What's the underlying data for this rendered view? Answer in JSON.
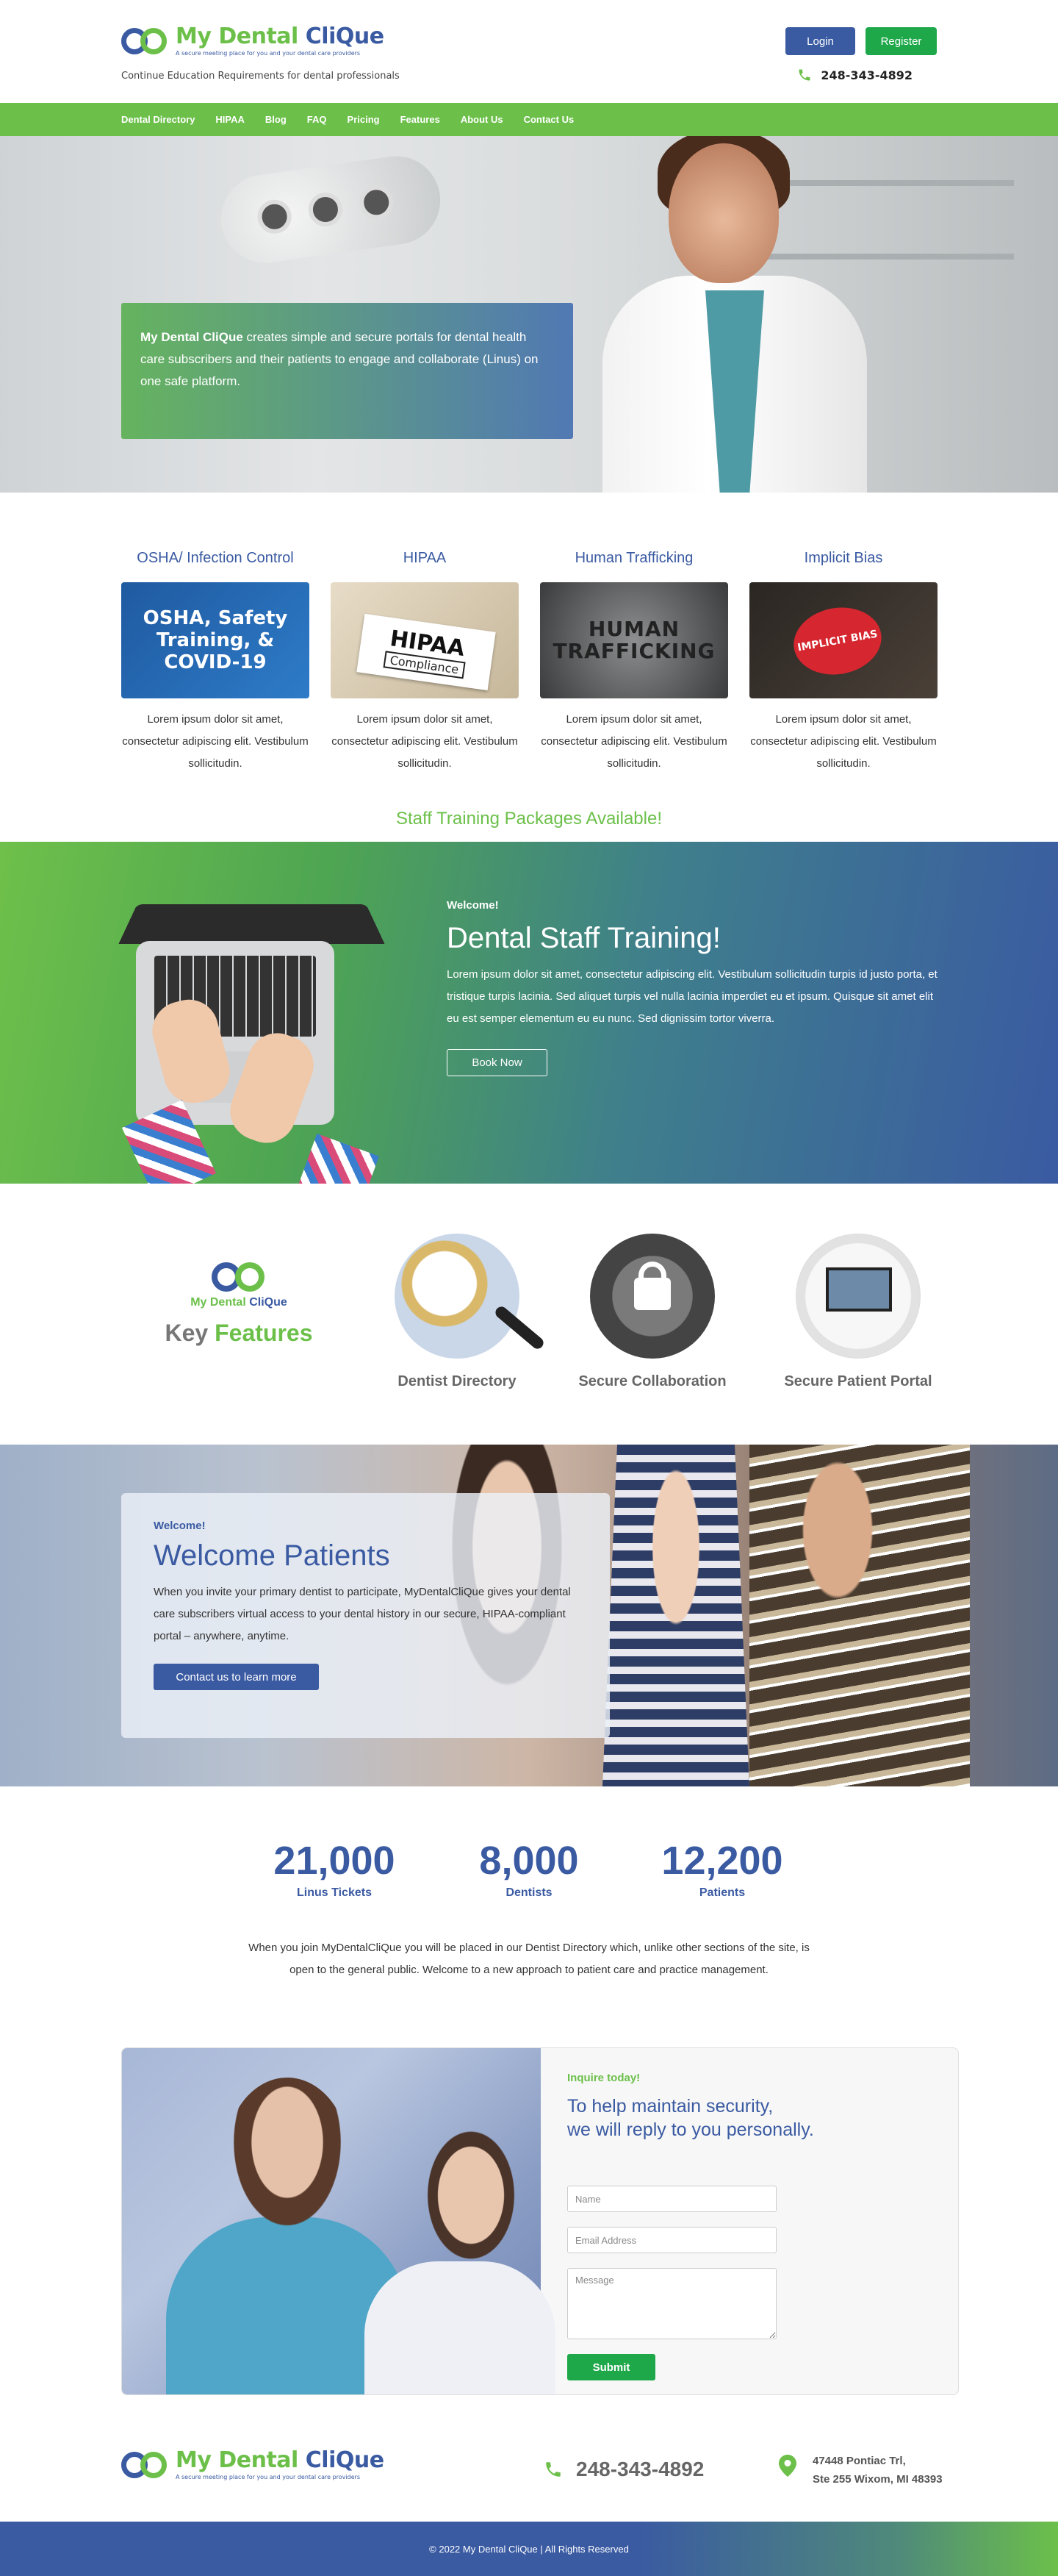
{
  "brand": {
    "name_part1": "My Dental ",
    "name_part2": "CliQue",
    "tagline_small": "A secure meeting place for you and your dental care providers",
    "colors": {
      "blue": "#3a5aa2",
      "green": "#6cc04a",
      "button_green": "#1ea84a"
    }
  },
  "header": {
    "tagline": "Continue Education Requirements for dental professionals",
    "login_label": "Login",
    "register_label": "Register",
    "phone": "248-343-4892",
    "phone_icon": "phone-icon"
  },
  "nav": {
    "items": [
      {
        "label": "Dental Directory"
      },
      {
        "label": "HIPAA"
      },
      {
        "label": "Blog"
      },
      {
        "label": "FAQ"
      },
      {
        "label": "Pricing"
      },
      {
        "label": "Features"
      },
      {
        "label": "About Us"
      },
      {
        "label": "Contact Us"
      }
    ]
  },
  "hero": {
    "brand_bold": "My Dental CliQue",
    "text": " creates simple and secure portals for dental health care subscribers and their patients to engage and collaborate (Linus) on one safe platform."
  },
  "topics": {
    "items": [
      {
        "title": "OSHA/ Infection Control",
        "image_text": "OSHA, Safety Training, & COVID-19",
        "text": "Lorem ipsum dolor sit amet, consectetur adipiscing elit. Vestibulum sollicitudin."
      },
      {
        "title": "HIPAA",
        "image_text": "HIPAA",
        "image_sub": "Compliance",
        "text": "Lorem ipsum dolor sit amet, consectetur adipiscing elit. Vestibulum sollicitudin."
      },
      {
        "title": "Human Trafficking",
        "image_text": "HUMAN TRAFFICKING",
        "text": "Lorem ipsum dolor sit amet, consectetur adipiscing elit. Vestibulum sollicitudin."
      },
      {
        "title": "Implicit Bias",
        "image_text": "IMPLICIT BIAS",
        "text": "Lorem ipsum dolor sit amet, consectetur adipiscing elit. Vestibulum sollicitudin."
      }
    ],
    "packages_label": "Staff Training Packages Available!"
  },
  "training": {
    "kicker": "Welcome!",
    "title": "Dental Staff Training!",
    "text": "Lorem ipsum dolor sit amet, consectetur adipiscing elit. Vestibulum sollicitudin turpis id justo porta, et tristique turpis lacinia. Sed aliquet turpis vel nulla lacinia imperdiet eu et ipsum. Quisque sit amet elit eu est semper elementum eu eu nunc. Sed dignissim tortor viverra.",
    "button_label": "Book Now"
  },
  "features": {
    "logo_part1": "My Dental ",
    "logo_part2": "CliQue",
    "title_part1": "Key ",
    "title_part2": "Features",
    "items": [
      {
        "label": "Dentist Directory",
        "icon": "magnifier-globe-icon"
      },
      {
        "label": "Secure Collaboration",
        "icon": "lock-network-icon"
      },
      {
        "label": "Secure Patient Portal",
        "icon": "monitor-icon"
      }
    ]
  },
  "patients": {
    "kicker": "Welcome!",
    "title": "Welcome Patients",
    "text": "When you invite your primary dentist to participate, MyDentalCliQue gives your dental care subscribers virtual access to your dental history in our secure, HIPAA-compliant portal – anywhere, anytime.",
    "button_label": "Contact us to learn more"
  },
  "stats": {
    "items": [
      {
        "value": "21,000",
        "label": "Linus Tickets"
      },
      {
        "value": "8,000",
        "label": "Dentists"
      },
      {
        "value": "12,200",
        "label": "Patients"
      }
    ],
    "text": "When you join MyDentalCliQue you will be placed in our Dentist Directory which, unlike other sections of the site, is open to the general public. Welcome to a new approach to patient care and practice management."
  },
  "inquire": {
    "kicker": "Inquire today!",
    "title_line1": "To help maintain security,",
    "title_line2": "we will reply to you personally.",
    "name_placeholder": "Name",
    "email_placeholder": "Email Address",
    "message_placeholder": "Message",
    "submit_label": "Submit"
  },
  "footer": {
    "phone": "248-343-4892",
    "address_line1": "47448 Pontiac Trl,",
    "address_line2": "Ste 255 Wixom, MI 48393",
    "copyright": "© 2022 My Dental CliQue | All Rights Reserved"
  }
}
